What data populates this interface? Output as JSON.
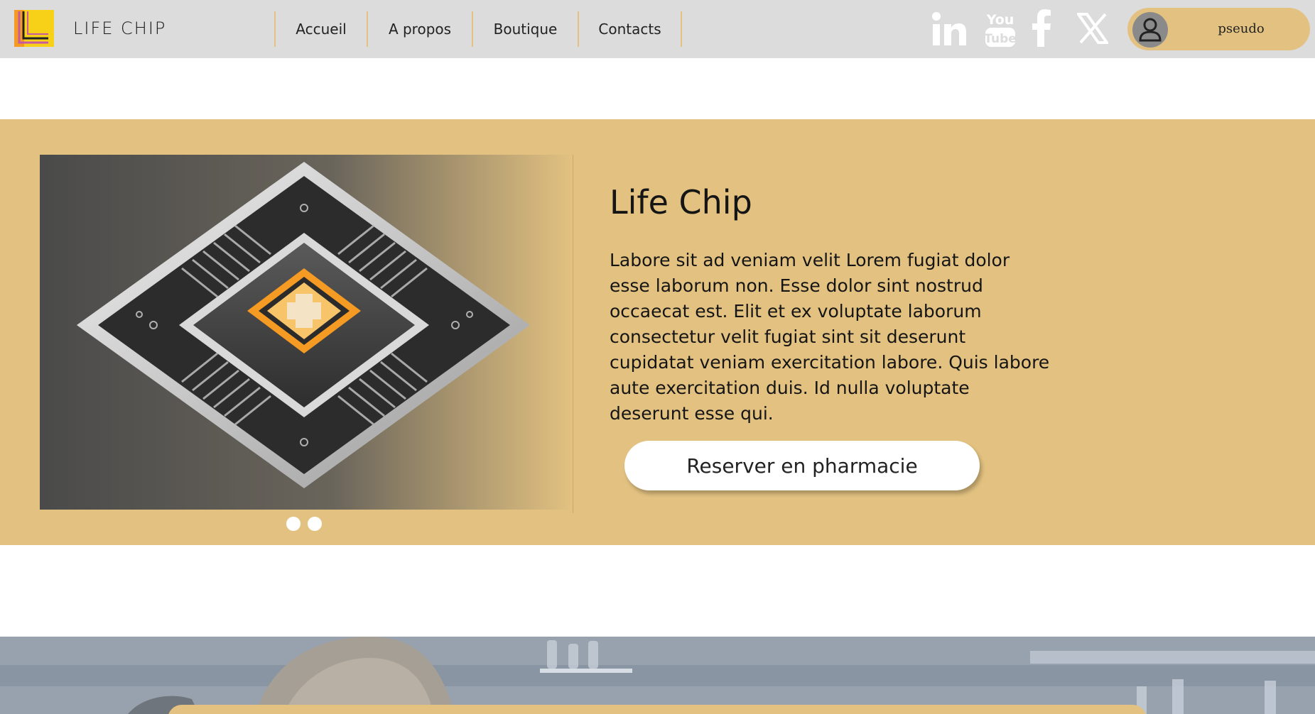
{
  "brand": {
    "name": "LIFE CHIP"
  },
  "nav": {
    "items": [
      "Accueil",
      "A propos",
      "Boutique",
      "Contacts"
    ]
  },
  "social": {
    "icons": [
      "linkedin-icon",
      "youtube-icon",
      "facebook-icon",
      "x-icon"
    ],
    "youtube_top": "You",
    "youtube_bottom": "Tube"
  },
  "user": {
    "name": "pseudo"
  },
  "hero": {
    "title": "Life Chip",
    "text": "Labore sit ad veniam velit Lorem fugiat dolor esse laborum non. Esse dolor sint nostrud occaecat est. Elit et ex voluptate laborum consectetur velit fugiat sint sit deserunt cupidatat veniam exercitation labore. Quis labore aute exercitation duis. Id nulla voluptate deserunt esse qui.",
    "button_label": "Reserver en pharmacie",
    "carousel_slide_count": 2
  },
  "colors": {
    "header_bg": "#dcdcdc",
    "accent": "#e3c281",
    "button_bg": "#ffffff",
    "logo_yellow": "#f7d117",
    "logo_orange": "#f59a23",
    "logo_pink": "#c85aa3"
  }
}
